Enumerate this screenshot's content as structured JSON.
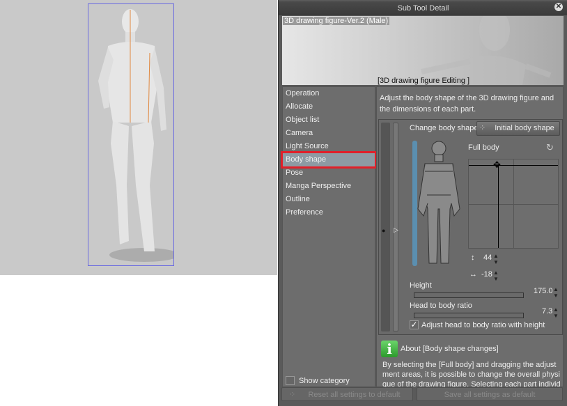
{
  "panel": {
    "title": "Sub Tool Detail",
    "preview_title": "3D drawing figure-Ver.2 (Male)",
    "preview_caption": "[3D drawing figure Editing ]"
  },
  "categories": [
    "Operation",
    "Allocate",
    "Object list",
    "Camera",
    "Light Source",
    "Body shape",
    "Pose",
    "Manga Perspective",
    "Outline",
    "Preference"
  ],
  "selected_category": "Body shape",
  "show_category": "Show category",
  "description": "Adjust the body shape of the 3D drawing figure and the dimensions of each part.",
  "body": {
    "change_label": "Change body shape",
    "initial_button": "Initial body shape",
    "full_body": "Full body",
    "vertical": "44",
    "horizontal": "-18",
    "height_label": "Height",
    "height_value": "175.0",
    "ratio_label": "Head to body ratio",
    "ratio_value": "7.3",
    "adjust_label": "Adjust head to body ratio with height",
    "adjust_checked": true
  },
  "about": {
    "title": "About [Body shape changes]",
    "text": "By selecting the [Full body] and dragging the adjustment areas, it is possible to change the overall physique of the drawing figure. Selecting each part individually an"
  },
  "footer": {
    "reset": "Reset all settings to default",
    "save": "Save all settings as default"
  },
  "colors": {
    "selection_highlight": "#e0202a",
    "accent_bar": "#5b8fb0"
  }
}
